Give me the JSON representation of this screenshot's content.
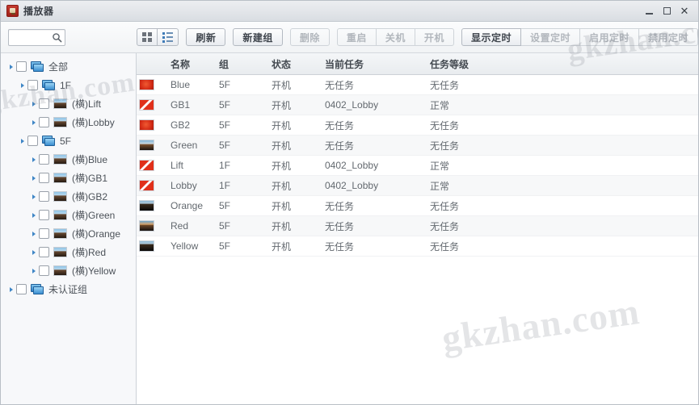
{
  "window": {
    "title": "播放器",
    "app_icon": "player-icon",
    "controls": {
      "minimize": "minimize-icon",
      "maximize": "maximize-icon",
      "close": "close-icon"
    }
  },
  "search": {
    "value": "",
    "placeholder": "",
    "icon": "search-icon"
  },
  "toolbar": {
    "view_grid_icon": "grid-view-icon",
    "view_list_icon": "list-view-icon",
    "refresh_label": "刷新",
    "new_group_label": "新建组",
    "delete_label": "删除",
    "restart_label": "重启",
    "shutdown_label": "关机",
    "poweron_label": "开机",
    "show_timer_label": "显示定时",
    "set_timer_label": "设置定时",
    "enable_timer_label": "启用定时",
    "disable_timer_label": "禁用定时"
  },
  "tree": {
    "nodes": [
      {
        "label": "全部",
        "depth": 0,
        "icon": "folder-icon"
      },
      {
        "label": "1F",
        "depth": 1,
        "icon": "folder-icon"
      },
      {
        "label": "(横)Lift",
        "depth": 2,
        "icon": "screen-icon"
      },
      {
        "label": "(横)Lobby",
        "depth": 2,
        "icon": "screen-icon"
      },
      {
        "label": "5F",
        "depth": 1,
        "icon": "folder-icon"
      },
      {
        "label": "(横)Blue",
        "depth": 2,
        "icon": "screen-icon"
      },
      {
        "label": "(横)GB1",
        "depth": 2,
        "icon": "screen-icon"
      },
      {
        "label": "(横)GB2",
        "depth": 2,
        "icon": "screen-icon"
      },
      {
        "label": "(横)Green",
        "depth": 2,
        "icon": "screen-icon"
      },
      {
        "label": "(横)Orange",
        "depth": 2,
        "icon": "screen-icon"
      },
      {
        "label": "(横)Red",
        "depth": 2,
        "icon": "screen-icon"
      },
      {
        "label": "(横)Yellow",
        "depth": 2,
        "icon": "screen-icon"
      },
      {
        "label": "未认证组",
        "depth": 0,
        "icon": "folder-icon"
      }
    ]
  },
  "table": {
    "columns": [
      "名称",
      "组",
      "状态",
      "当前任务",
      "任务等级"
    ],
    "rows": [
      {
        "thumb": "red-solid",
        "name": "Blue",
        "group": "5F",
        "state": "开机",
        "task": "无任务",
        "level": "无任务"
      },
      {
        "thumb": "red-logo",
        "name": "GB1",
        "group": "5F",
        "state": "开机",
        "task": "0402_Lobby",
        "level": "正常"
      },
      {
        "thumb": "red-solid",
        "name": "GB2",
        "group": "5F",
        "state": "开机",
        "task": "无任务",
        "level": "无任务"
      },
      {
        "thumb": "sunset",
        "name": "Green",
        "group": "5F",
        "state": "开机",
        "task": "无任务",
        "level": "无任务"
      },
      {
        "thumb": "red-logo",
        "name": "Lift",
        "group": "1F",
        "state": "开机",
        "task": "0402_Lobby",
        "level": "正常"
      },
      {
        "thumb": "red-logo",
        "name": "Lobby",
        "group": "1F",
        "state": "开机",
        "task": "0402_Lobby",
        "level": "正常"
      },
      {
        "thumb": "dark",
        "name": "Orange",
        "group": "5F",
        "state": "开机",
        "task": "无任务",
        "level": "无任务"
      },
      {
        "thumb": "sunset2",
        "name": "Red",
        "group": "5F",
        "state": "开机",
        "task": "无任务",
        "level": "无任务"
      },
      {
        "thumb": "dark",
        "name": "Yellow",
        "group": "5F",
        "state": "开机",
        "task": "无任务",
        "level": "无任务"
      }
    ]
  },
  "watermark": {
    "text": "gkzhan.com"
  }
}
